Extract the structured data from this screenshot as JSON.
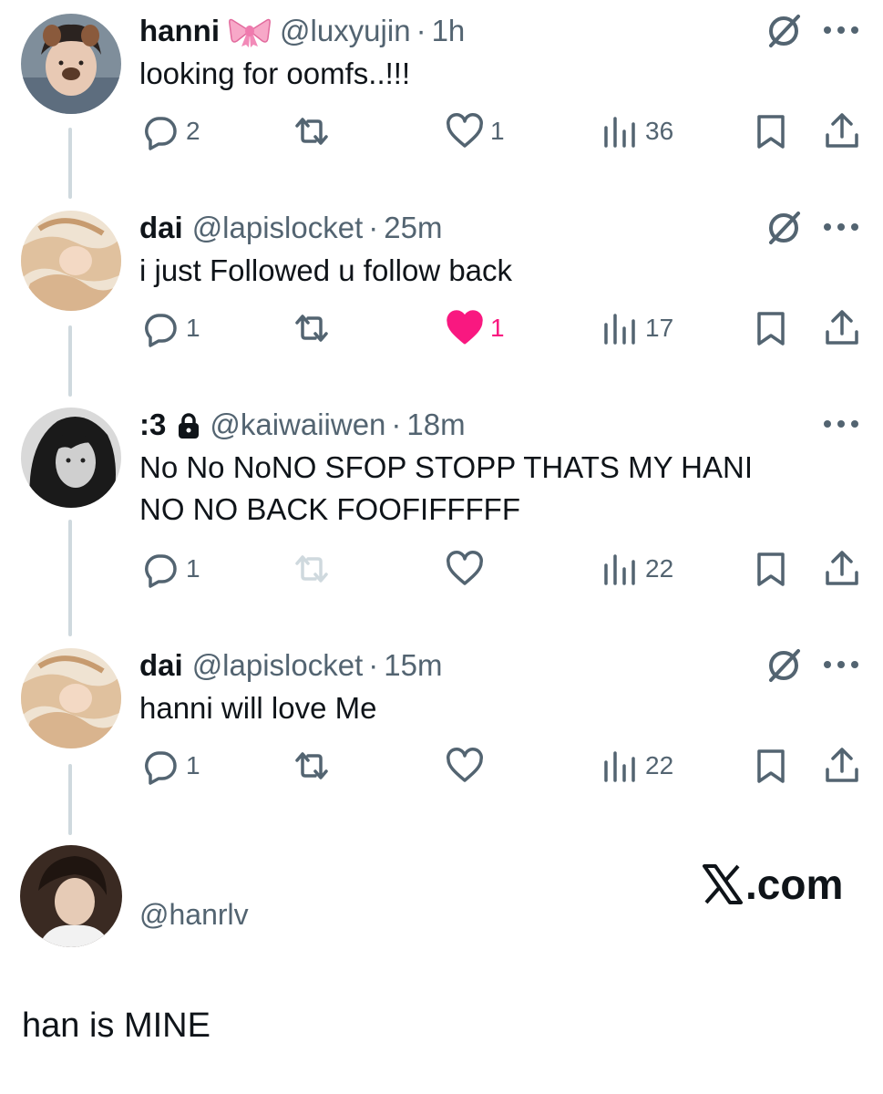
{
  "tweets": [
    {
      "name": "hanni",
      "handle": "@luxyujin",
      "time": "1h",
      "text_lines": [
        "looking for oomfs..!!!"
      ],
      "has_emoji": "ribbon-emoji",
      "has_grok": true,
      "replies": "2",
      "retweets": "",
      "likes": "1",
      "liked": false,
      "views": "36"
    },
    {
      "name": "dai",
      "handle": "@lapislocket",
      "time": "25m",
      "text_lines": [
        "i just Followed u follow back"
      ],
      "has_grok": true,
      "replies": "1",
      "retweets": "",
      "likes": "1",
      "liked": true,
      "views": "17"
    },
    {
      "name": ":3",
      "handle": "@kaiwaiiwen",
      "time": "18m",
      "text_lines": [
        "No No NoNO SFOP STOPP THATS MY HANI",
        "NO NO BACK FOOFIFFFFF"
      ],
      "locked": true,
      "has_grok": false,
      "replies": "1",
      "retweets": "",
      "retweet_disabled": true,
      "likes": "",
      "liked": false,
      "views": "22"
    },
    {
      "name": "dai",
      "handle": "@lapislocket",
      "time": "15m",
      "text_lines": [
        "hanni will love Me"
      ],
      "has_grok": true,
      "replies": "1",
      "retweets": "",
      "likes": "",
      "liked": false,
      "views": "22"
    }
  ],
  "separator": "·",
  "footer": {
    "handle": "@hanrlv",
    "brand": ".com"
  },
  "caption": "han is MINE",
  "colors": {
    "text": "#0f1419",
    "muted": "#536471",
    "like_active": "#f91880",
    "thread_line": "#cfd9de",
    "disabled": "#cfd9de"
  }
}
